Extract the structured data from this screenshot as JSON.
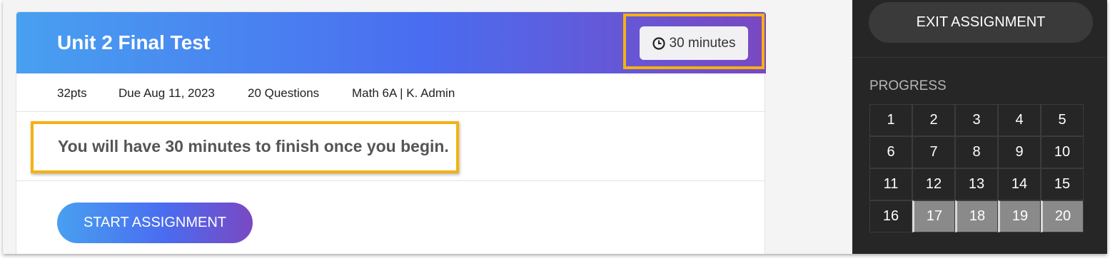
{
  "assignment": {
    "title": "Unit 2 Final Test",
    "timer_label": "30 minutes",
    "meta": {
      "points": "32pts",
      "due": "Due Aug 11, 2023",
      "questions": "20 Questions",
      "class_info": "Math 6A | K. Admin"
    },
    "notice": "You will have 30 minutes to finish once you begin.",
    "start_label": "START ASSIGNMENT"
  },
  "sidebar": {
    "exit_label": "EXIT ASSIGNMENT",
    "progress_label": "PROGRESS",
    "questions": [
      "1",
      "2",
      "3",
      "4",
      "5",
      "6",
      "7",
      "8",
      "9",
      "10",
      "11",
      "12",
      "13",
      "14",
      "15",
      "16",
      "17",
      "18",
      "19",
      "20"
    ],
    "answered": [
      "17",
      "18",
      "19",
      "20"
    ]
  },
  "colors": {
    "highlight": "#f5b111",
    "gradient_start": "#48a0f0",
    "gradient_end": "#7a48c2",
    "sidebar_bg": "#262626"
  },
  "icons": {
    "timer": "clock-icon"
  }
}
